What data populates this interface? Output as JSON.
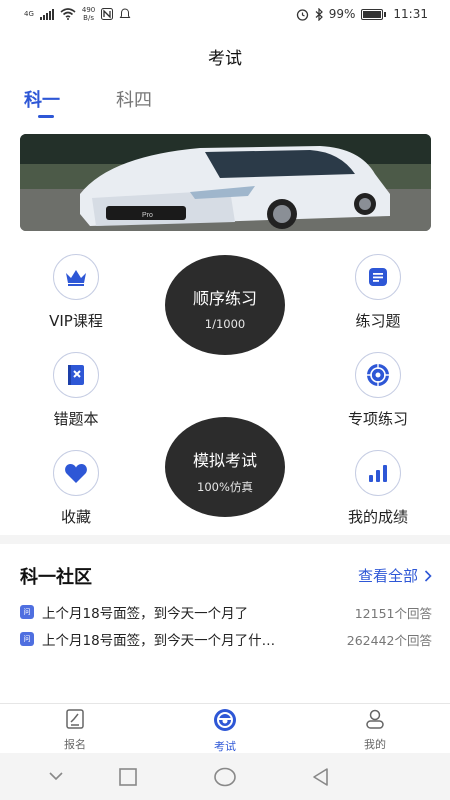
{
  "status_bar": {
    "network": "4G",
    "speed": "490\nB/s",
    "speed_value": "490",
    "speed_unit": "B/s",
    "battery": "99%",
    "time": "11:31",
    "battery_level": 0.99
  },
  "header": {
    "title": "考试"
  },
  "tabs": [
    {
      "label": "科一",
      "active": true
    },
    {
      "label": "科四",
      "active": false
    }
  ],
  "banner": {
    "plate_text": "Pro"
  },
  "features": {
    "vip": {
      "label": "VIP课程",
      "icon": "crown-icon"
    },
    "practice": {
      "label": "练习题",
      "icon": "document-icon"
    },
    "wrong": {
      "label": "错题本",
      "icon": "notebook-x-icon"
    },
    "special": {
      "label": "专项练习",
      "icon": "target-icon"
    },
    "favorite": {
      "label": "收藏",
      "icon": "heart-icon"
    },
    "score": {
      "label": "我的成绩",
      "icon": "bar-chart-icon"
    }
  },
  "sequence": {
    "title": "顺序练习",
    "progress": "1/1000"
  },
  "mock": {
    "title": "模拟考试",
    "subtitle": "100%仿真"
  },
  "community": {
    "title": "科一社区",
    "view_all": "查看全部",
    "questions": [
      {
        "badge": "问",
        "text": "上个月18号面签，到今天一个月了",
        "count": "12151个回答"
      },
      {
        "badge": "问",
        "text": "上个月18号面签，到今天一个月了什…",
        "count": "262442个回答"
      }
    ]
  },
  "bottom_nav": [
    {
      "label": "报名",
      "icon": "register-icon",
      "active": false
    },
    {
      "label": "考试",
      "icon": "steering-wheel-icon",
      "active": true
    },
    {
      "label": "我的",
      "icon": "user-icon",
      "active": false
    }
  ],
  "colors": {
    "accent": "#2e57d6",
    "dark_circle": "#2c2c2c"
  }
}
